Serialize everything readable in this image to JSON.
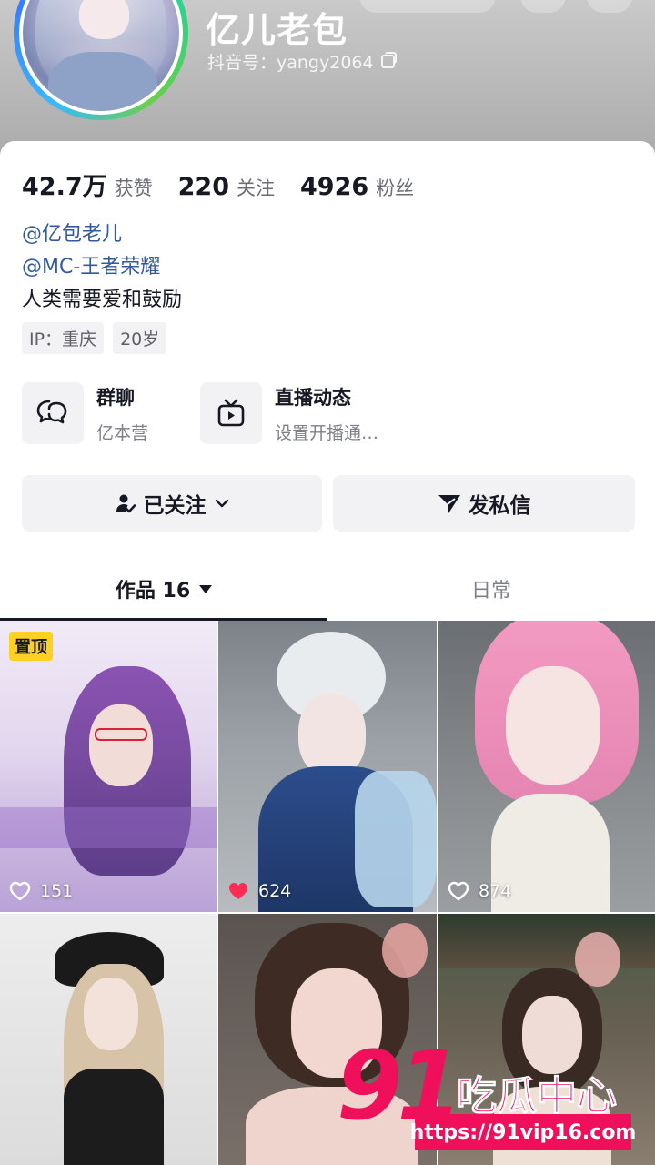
{
  "profile": {
    "username": "亿儿老包",
    "douyin_id": "抖音号：yangy2064",
    "stats": [
      {
        "num": "42.7万",
        "label": "获赞"
      },
      {
        "num": "220",
        "label": "关注"
      },
      {
        "num": "4926",
        "label": "粉丝"
      }
    ],
    "links": [
      "@亿包老儿",
      "@MC-王者荣耀"
    ],
    "bio": "人类需要爱和鼓励",
    "tags": [
      "IP：重庆",
      "20岁"
    ]
  },
  "features": [
    {
      "title": "群聊",
      "subtitle": "亿本营",
      "icon": "chat-bubbles-icon"
    },
    {
      "title": "直播动态",
      "subtitle": "设置开播通…",
      "icon": "tv-icon"
    }
  ],
  "actions": {
    "follow_label": "已关注",
    "message_label": "发私信"
  },
  "tabs": {
    "works_label": "作品 16",
    "daily_label": "日常"
  },
  "videos": [
    {
      "likes": "151",
      "pinned": true,
      "pin_label": "置顶",
      "liked": false
    },
    {
      "likes": "624",
      "pinned": false,
      "liked": true
    },
    {
      "likes": "874",
      "pinned": false,
      "liked": false
    },
    {
      "likes": "",
      "pinned": false,
      "liked": false
    },
    {
      "likes": "",
      "pinned": false,
      "liked": false
    },
    {
      "likes": "",
      "pinned": false,
      "liked": false
    }
  ],
  "watermark": {
    "number": "91",
    "text": "吃瓜中心",
    "url": "https://91vip16.com"
  },
  "colors": {
    "link": "#325a9c",
    "like_red": "#fe2c55",
    "pin_yellow": "#fed023",
    "watermark": "#f00f5b"
  }
}
